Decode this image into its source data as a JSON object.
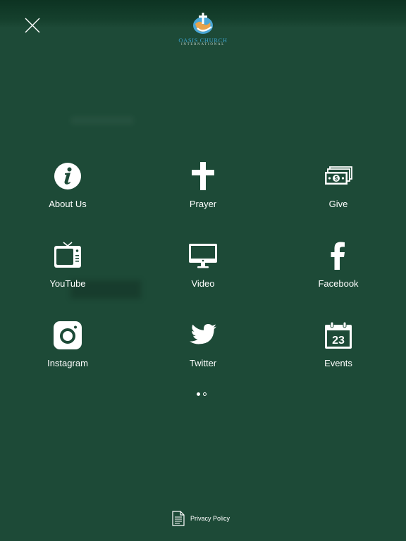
{
  "logo": {
    "line1": "OASIS CHURCH",
    "line2": "INTERNATIONAL"
  },
  "menu": [
    {
      "id": "about",
      "label": "About Us",
      "icon": "info-icon"
    },
    {
      "id": "prayer",
      "label": "Prayer",
      "icon": "cross-icon"
    },
    {
      "id": "give",
      "label": "Give",
      "icon": "money-icon"
    },
    {
      "id": "youtube",
      "label": "YouTube",
      "icon": "tv-icon"
    },
    {
      "id": "video",
      "label": "Video",
      "icon": "monitor-icon"
    },
    {
      "id": "facebook",
      "label": "Facebook",
      "icon": "facebook-icon"
    },
    {
      "id": "instagram",
      "label": "Instagram",
      "icon": "instagram-icon"
    },
    {
      "id": "twitter",
      "label": "Twitter",
      "icon": "twitter-icon"
    },
    {
      "id": "events",
      "label": "Events",
      "icon": "calendar-icon"
    }
  ],
  "events_icon_day": "23",
  "pagination": {
    "current": 1,
    "total": 2
  },
  "footer": {
    "privacy_label": "Privacy Policy"
  },
  "colors": {
    "background": "#1d4a37",
    "logo_blue": "#3aa0c8",
    "icon": "#ffffff"
  }
}
